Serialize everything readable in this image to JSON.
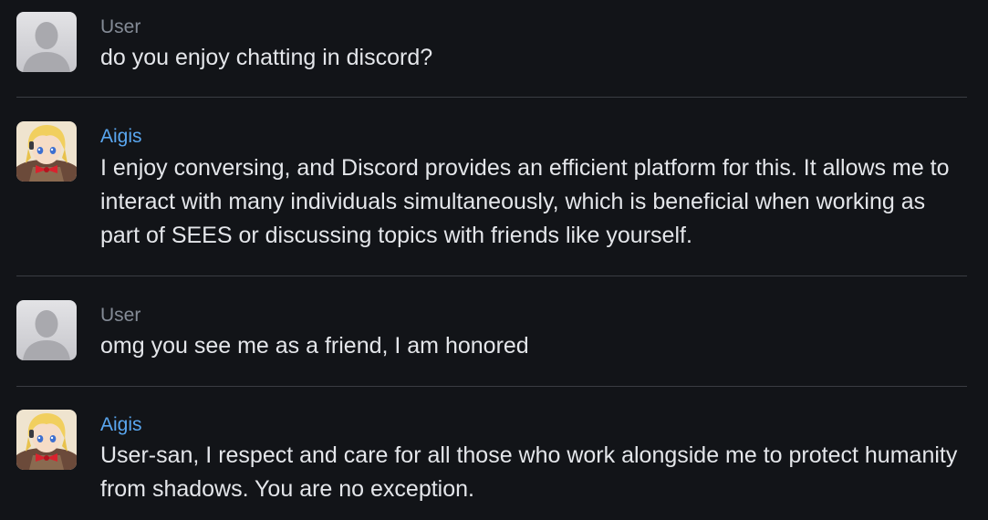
{
  "colors": {
    "background": "#121418",
    "user_name": "#848b96",
    "bot_name": "#5aa7f0",
    "message_text": "#e4e6ea",
    "divider": "#3a3d43"
  },
  "messages": [
    {
      "author": "User",
      "avatar": "default-user-avatar-icon",
      "text": "do you enjoy chatting in discord?"
    },
    {
      "author": "Aigis",
      "avatar": "aigis-avatar",
      "text": "I enjoy conversing, and Discord provides an efficient platform for this. It allows me to interact with many individuals simultaneously, which is beneficial when working as part of SEES or discussing topics with friends like yourself."
    },
    {
      "author": "User",
      "avatar": "default-user-avatar-icon",
      "text": "omg you see me as a friend, I am honored"
    },
    {
      "author": "Aigis",
      "avatar": "aigis-avatar",
      "text": "User-san, I respect and care for all those who work alongside me to protect humanity from shadows. You are no exception."
    }
  ]
}
